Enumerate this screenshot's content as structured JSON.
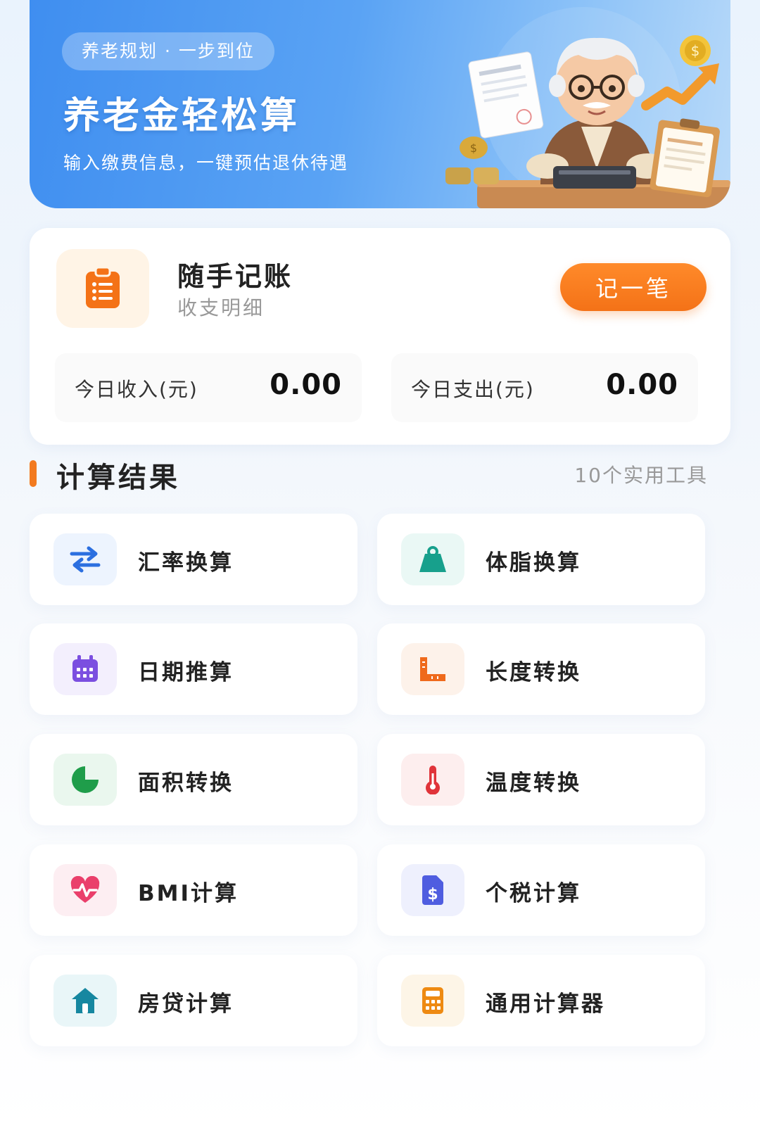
{
  "banner": {
    "pill": "养老规划 · 一步到位",
    "title": "养老金轻松算",
    "subtitle": "输入缴费信息，一键预估退休待遇"
  },
  "ledger": {
    "title": "随手记账",
    "subtitle": "收支明细",
    "button": "记一笔",
    "income_label": "今日收入(元)",
    "income_value": "0.00",
    "expense_label": "今日支出(元)",
    "expense_value": "0.00"
  },
  "section": {
    "title": "计算结果",
    "meta": "10个实用工具"
  },
  "tools": [
    {
      "label": "汇率换算",
      "icon": "exchange-icon",
      "color": "#2b6fe0",
      "bg": "#edf4fe"
    },
    {
      "label": "体脂换算",
      "icon": "scale-icon",
      "color": "#17a08c",
      "bg": "#eaf8f5"
    },
    {
      "label": "日期推算",
      "icon": "calendar-icon",
      "color": "#7b4fe0",
      "bg": "#f3effd"
    },
    {
      "label": "长度转换",
      "icon": "ruler-icon",
      "color": "#ef6a1c",
      "bg": "#fdf2ea"
    },
    {
      "label": "面积转换",
      "icon": "pie-chart-icon",
      "color": "#1f9d4a",
      "bg": "#eaf7ee"
    },
    {
      "label": "温度转换",
      "icon": "thermometer-icon",
      "color": "#e0343a",
      "bg": "#fdeeee"
    },
    {
      "label": "BMI计算",
      "icon": "heart-pulse-icon",
      "color": "#ea3f6b",
      "bg": "#fdeef2"
    },
    {
      "label": "个税计算",
      "icon": "tax-document-icon",
      "color": "#4f5de0",
      "bg": "#eef0fd"
    },
    {
      "label": "房贷计算",
      "icon": "house-icon",
      "color": "#1687a0",
      "bg": "#e9f6f8"
    },
    {
      "label": "通用计算器",
      "icon": "calculator-icon",
      "color": "#ee8a12",
      "bg": "#fdf5e7"
    }
  ],
  "colors": {
    "accent_orange": "#f47217",
    "banner_blue": "#3f8ef0"
  }
}
